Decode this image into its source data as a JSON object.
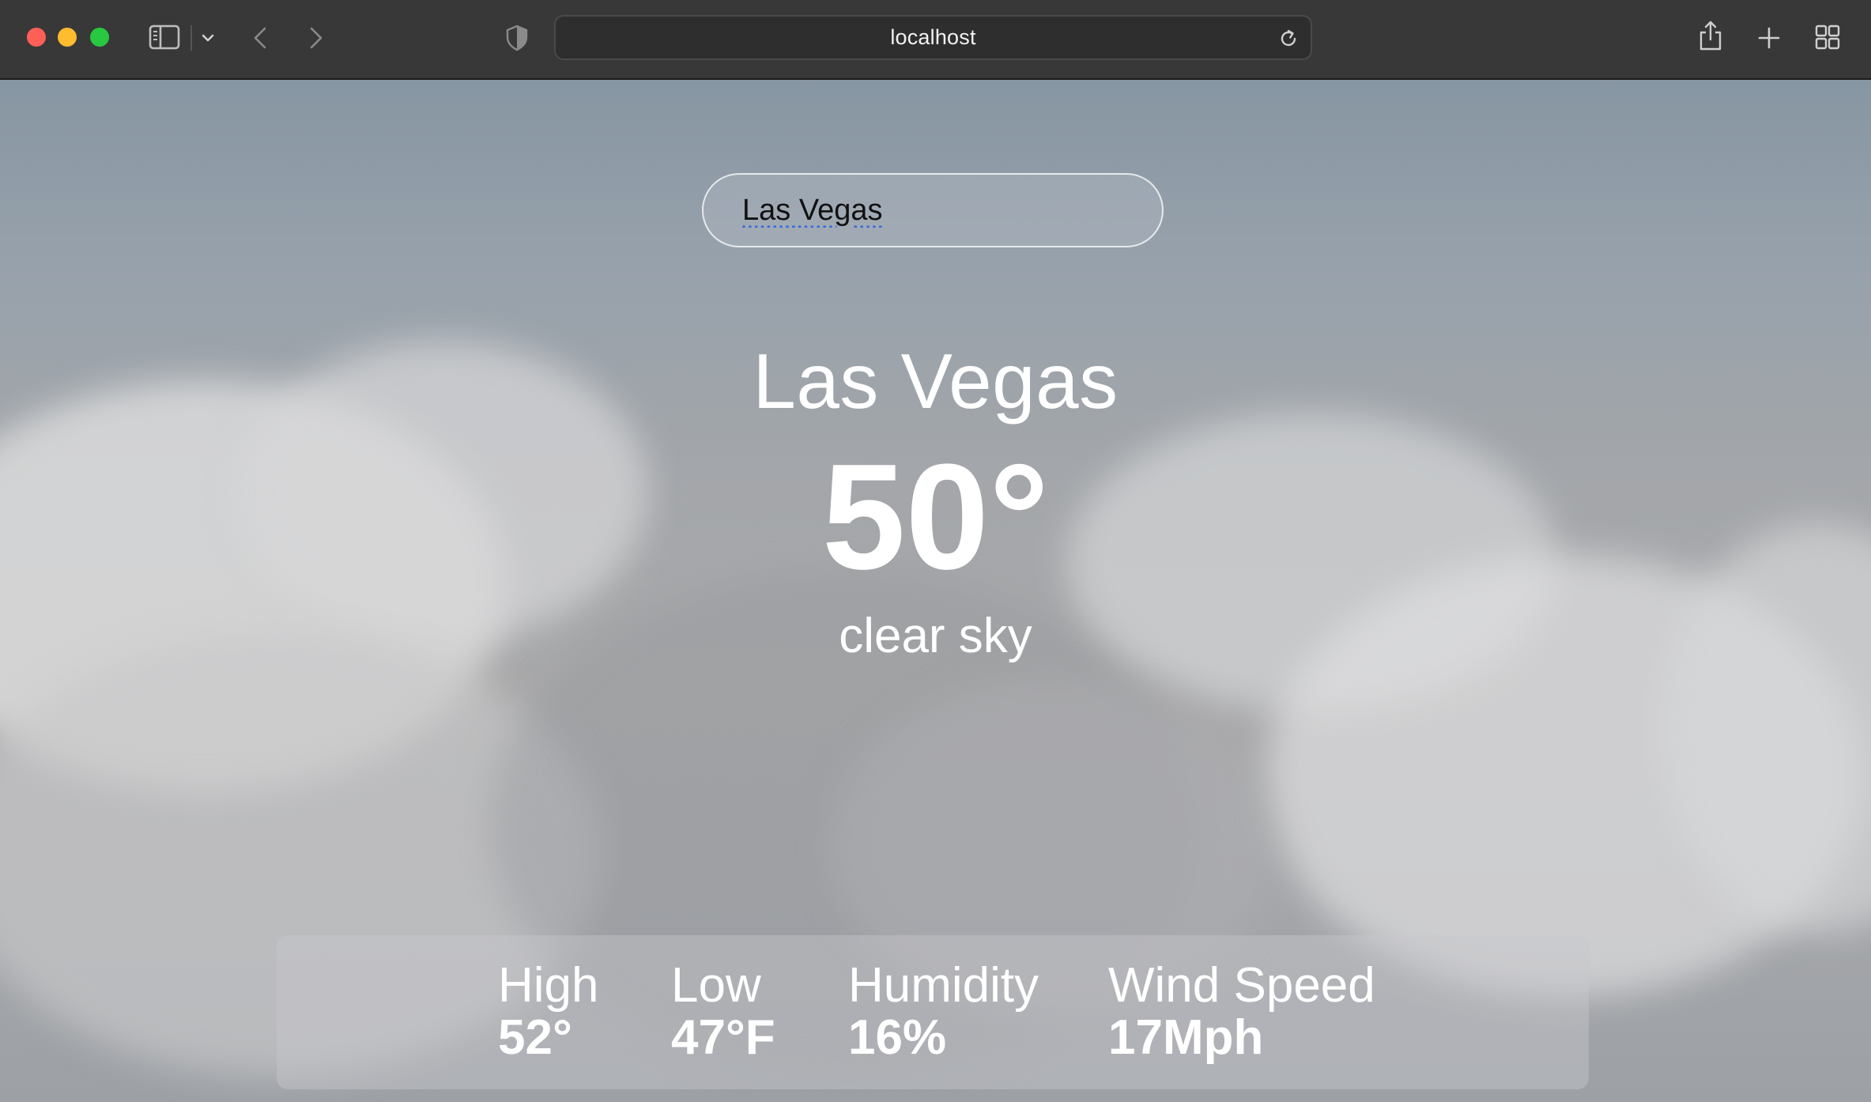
{
  "browser": {
    "url": "localhost",
    "icons": {
      "sidebar": "sidebar-icon",
      "sidebar_menu": "chevron-down-icon",
      "back": "chevron-left-icon",
      "forward": "chevron-right-icon",
      "privacy": "shield-icon",
      "reload": "reload-icon",
      "share": "share-icon",
      "new_tab": "plus-icon",
      "tab_overview": "grid-icon"
    }
  },
  "search": {
    "value": "Las Vegas"
  },
  "weather": {
    "city": "Las Vegas",
    "temperature": "50°",
    "description": "clear sky",
    "stats": {
      "high": {
        "label": "High",
        "value": "52°"
      },
      "low": {
        "label": "Low",
        "value": "47°F"
      },
      "humidity": {
        "label": "Humidity",
        "value": "16%"
      },
      "wind": {
        "label": "Wind Speed",
        "value": "17Mph"
      }
    }
  },
  "colors": {
    "chrome_background": "#383838",
    "url_bar": "#2e2e2e",
    "text_white": "#ffffff",
    "close": "#fe5f57",
    "minimize": "#febc2e",
    "zoom": "#28c840"
  }
}
